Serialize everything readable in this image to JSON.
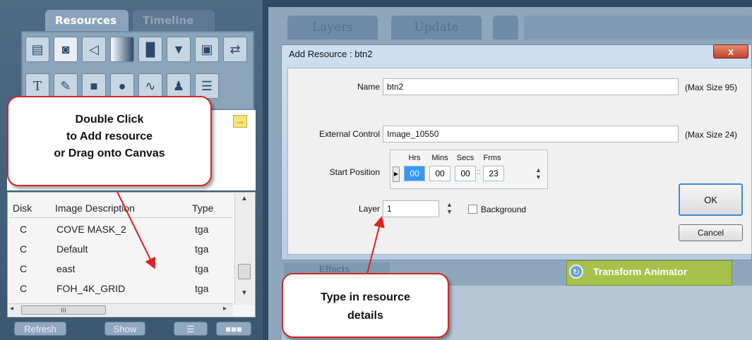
{
  "left_panel": {
    "tabs": [
      "Resources",
      "Timeline"
    ],
    "toolbar_icons_row1": [
      "film-icon",
      "camera-icon",
      "speaker-icon",
      "gradient-icon",
      "color-fill-icon",
      "shape-icon",
      "window-icon",
      "swap-icon"
    ],
    "toolbar_icons_row2": [
      "text-icon",
      "brush-icon",
      "square-icon",
      "circle-icon",
      "wave-icon",
      "person-icon",
      "list-icon"
    ],
    "list": {
      "headers": [
        "Disk",
        "Image Description",
        "Type"
      ],
      "rows": [
        {
          "disk": "C",
          "desc": "COVE MASK_2",
          "type": "tga"
        },
        {
          "disk": "C",
          "desc": "Default",
          "type": "tga"
        },
        {
          "disk": "C",
          "desc": "east",
          "type": "tga"
        },
        {
          "disk": "C",
          "desc": "FOH_4K_GRID",
          "type": "tga"
        }
      ],
      "hscroll_label": "III"
    },
    "buttons": {
      "refresh": "Refresh",
      "show": "Show"
    }
  },
  "right_panel": {
    "tabs": [
      "Layers",
      "Update"
    ],
    "effects_tab": "Effects",
    "transform_label": "Transform Animator"
  },
  "dialog": {
    "title": "Add Resource : btn2",
    "close": "x",
    "name_label": "Name",
    "name_value": "btn2",
    "name_note": "(Max Size 95)",
    "ext_label": "External Control",
    "ext_value": "Image_10550",
    "ext_note": "(Max Size 24)",
    "start_label": "Start Position",
    "time_headers": [
      "Hrs",
      "Mins",
      "Secs",
      "Frms"
    ],
    "time_values": [
      "00",
      "00",
      "00",
      "23"
    ],
    "layer_label": "Layer",
    "layer_value": "1",
    "background_label": "Background",
    "ok": "OK",
    "cancel": "Cancel"
  },
  "callouts": {
    "drag": [
      "Double Click",
      "to Add resource",
      "or Drag onto Canvas"
    ],
    "type": [
      "Type in resource",
      "details"
    ]
  },
  "colors": {
    "callout_border": "#d02828",
    "arrow": "#e02020",
    "accent_green": "#a6c24a"
  }
}
